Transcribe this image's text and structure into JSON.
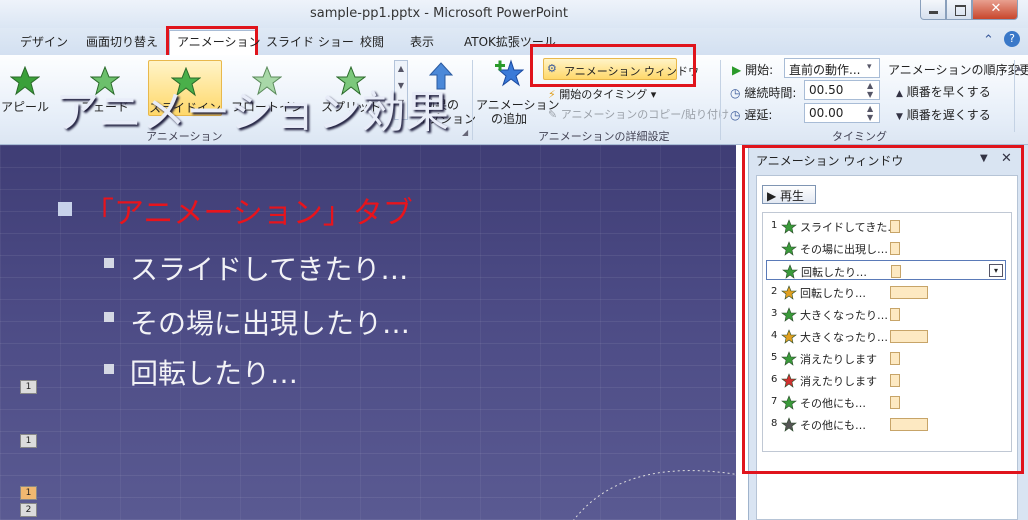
{
  "window": {
    "title": "sample-pp1.pptx - Microsoft PowerPoint",
    "close": "✕"
  },
  "tabs": [
    {
      "label": "デザイン"
    },
    {
      "label": "画面切り替え"
    },
    {
      "label": "アニメーション",
      "active": true
    },
    {
      "label": "スライド ショー"
    },
    {
      "label": "校閲"
    },
    {
      "label": "表示"
    },
    {
      "label": "ATOK拡張ツール"
    }
  ],
  "ribbon": {
    "effects": [
      {
        "label": "アピール",
        "color": "#3aa03a"
      },
      {
        "label": "フェード",
        "color": "#6cc06c"
      },
      {
        "label": "スライドイン",
        "color": "#4ab04a",
        "selected": true
      },
      {
        "label": "フロートイン",
        "color": "#a8d8a8"
      },
      {
        "label": "スプリット",
        "color": "#7cc87c"
      }
    ],
    "effect_options": [
      "効果の",
      "オプション"
    ],
    "group_animation": "アニメーション",
    "add_animation": [
      "アニメーション",
      "の追加"
    ],
    "anim_pane_btn": "アニメーション ウィンドウ",
    "trigger": "開始のタイミング",
    "copy": "アニメーションのコピー/貼り付け",
    "group_advanced": "アニメーションの詳細設定",
    "start_label": "開始:",
    "start_value": "直前の動作...",
    "duration_label": "継続時間:",
    "duration_value": "00.50",
    "delay_label": "遅延:",
    "delay_value": "00.00",
    "group_timing": "タイミング",
    "reorder": "アニメーションの順序変更",
    "move_earlier": "順番を早くする",
    "move_later": "順番を遅くする"
  },
  "slide": {
    "title": "アニメーション効果",
    "heading": "「アニメーション」タブ",
    "heading_color": "#e8141c",
    "bullets": [
      "スライドしてきたり…",
      "その場に出現したり…",
      "回転したり…"
    ],
    "markers": [
      "1",
      "1",
      "1",
      "2"
    ]
  },
  "pane": {
    "title": "アニメーション ウィンドウ",
    "play": "▶ 再生",
    "items": [
      {
        "num": "1",
        "label": "スライドしてきた…",
        "icon_color": "#3a9a3a",
        "progress": 0.12
      },
      {
        "num": "",
        "label": "その場に出現し…",
        "icon_color": "#3a9a3a",
        "progress": 0.12
      },
      {
        "num": "",
        "label": "回転したり…",
        "icon_color": "#3a9a3a",
        "progress": 0.12,
        "selected": true
      },
      {
        "num": "2",
        "label": "回転したり…",
        "icon_color": "#e0a020",
        "progress": 0.45
      },
      {
        "num": "3",
        "label": "大きくなったり…",
        "icon_color": "#3a9a3a",
        "progress": 0.12
      },
      {
        "num": "4",
        "label": "大きくなったり…",
        "icon_color": "#e0a020",
        "progress": 0.45
      },
      {
        "num": "5",
        "label": "消えたりします",
        "icon_color": "#3a9a3a",
        "progress": 0.12
      },
      {
        "num": "6",
        "label": "消えたりします",
        "icon_color": "#d03030",
        "progress": 0.12
      },
      {
        "num": "7",
        "label": "その他にも…",
        "icon_color": "#3a9a3a",
        "progress": 0.12
      },
      {
        "num": "8",
        "label": "その他にも…",
        "icon_color": "#555555",
        "progress": 0.45
      }
    ]
  }
}
